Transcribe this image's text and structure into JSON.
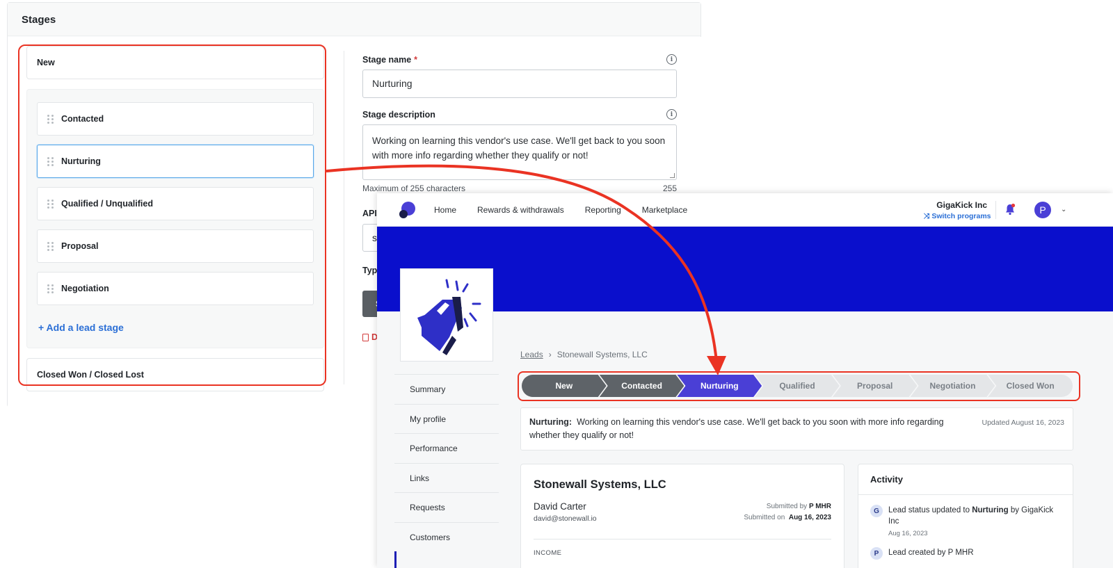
{
  "admin": {
    "header_title": "Stages",
    "stages_top": "New",
    "stages": [
      {
        "label": "Contacted"
      },
      {
        "label": "Nurturing"
      },
      {
        "label": "Qualified / Unqualified"
      },
      {
        "label": "Proposal"
      },
      {
        "label": "Negotiation"
      }
    ],
    "selected_stage": "Nurturing",
    "add_stage_label": "+ Add a lead stage",
    "stages_bottom": "Closed Won / Closed Lost",
    "form": {
      "stage_name_label": "Stage name",
      "required_mark": "*",
      "stage_name_value": "Nurturing",
      "stage_description_label": "Stage description",
      "stage_description_value": "Working on learning this vendor's use case. We'll get back to you soon with more info regarding whether they qualify or not!",
      "max_chars_label": "Maximum of 255 characters",
      "char_count": "255",
      "api_label_partial": "API st",
      "api_value_partial": "sta",
      "type_label_partial": "Type:",
      "save_partial": "Sa",
      "delete_partial": "Del"
    }
  },
  "portal": {
    "nav": {
      "links": [
        "Home",
        "Rewards & withdrawals",
        "Reporting",
        "Marketplace"
      ],
      "org_name": "GigaKick Inc",
      "switch_label": "Switch programs",
      "avatar_letter": "P"
    },
    "colors": {
      "banner": "#0a0fcc",
      "accent": "#4a3fd6",
      "highlight": "#ea3323"
    },
    "sidebar": [
      "Summary",
      "My profile",
      "Performance",
      "Links",
      "Requests",
      "Customers"
    ],
    "breadcrumb": {
      "root": "Leads",
      "separator": "›",
      "current": "Stonewall Systems, LLC"
    },
    "pipeline": [
      {
        "label": "New",
        "state": "done"
      },
      {
        "label": "Contacted",
        "state": "done"
      },
      {
        "label": "Nurturing",
        "state": "current"
      },
      {
        "label": "Qualified",
        "state": "upcoming"
      },
      {
        "label": "Proposal",
        "state": "upcoming"
      },
      {
        "label": "Negotiation",
        "state": "upcoming"
      },
      {
        "label": "Closed Won",
        "state": "upcoming"
      }
    ],
    "stage_description": {
      "stage": "Nurturing:",
      "text": "Working on learning this vendor's use case. We'll get back to you soon with more info regarding whether they qualify or not!",
      "updated": "Updated August 16, 2023"
    },
    "lead": {
      "company": "Stonewall Systems, LLC",
      "contact_name": "David Carter",
      "contact_email": "david@stonewall.io",
      "submitted_by_label": "Submitted by",
      "submitted_by": "P MHR",
      "submitted_on_label": "Submitted on",
      "submitted_on": "Aug 16, 2023",
      "section_label": "INCOME"
    },
    "activity": {
      "title": "Activity",
      "items": [
        {
          "avatar": "G",
          "prefix": "Lead status updated to",
          "bold": "Nurturing",
          "suffix": "by GigaKick Inc",
          "date": "Aug 16, 2023"
        },
        {
          "avatar": "P",
          "prefix": "Lead created by P MHR",
          "bold": "",
          "suffix": "",
          "date": ""
        }
      ]
    }
  }
}
